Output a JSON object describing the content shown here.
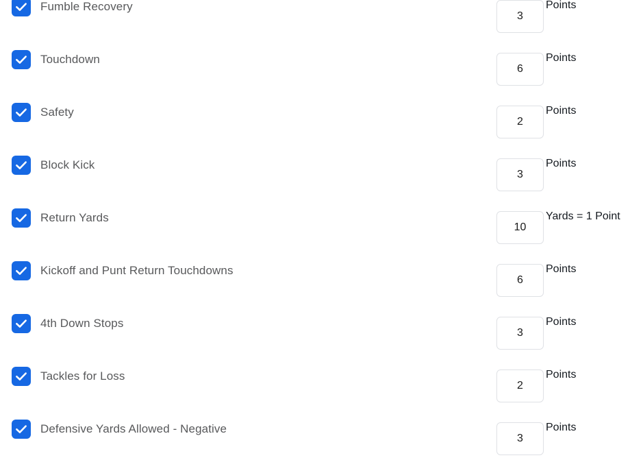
{
  "theme": {
    "background": "#ffffff",
    "checkbox_checked": "#1668e3",
    "checkbox_check_mark": "#ffffff",
    "label_color": "#58595b",
    "unit_color": "#14191f",
    "input_border": "#dfe1e5"
  },
  "scoring_rules": [
    {
      "label": "Fumble Recovery",
      "checked": true,
      "value": "3",
      "unit": "Points"
    },
    {
      "label": "Touchdown",
      "checked": true,
      "value": "6",
      "unit": "Points"
    },
    {
      "label": "Safety",
      "checked": true,
      "value": "2",
      "unit": "Points"
    },
    {
      "label": "Block Kick",
      "checked": true,
      "value": "3",
      "unit": "Points"
    },
    {
      "label": "Return Yards",
      "checked": true,
      "value": "10",
      "unit": "Yards = 1 Point"
    },
    {
      "label": "Kickoff and Punt Return Touchdowns",
      "checked": true,
      "value": "6",
      "unit": "Points"
    },
    {
      "label": "4th Down Stops",
      "checked": true,
      "value": "3",
      "unit": "Points"
    },
    {
      "label": "Tackles for Loss",
      "checked": true,
      "value": "2",
      "unit": "Points"
    },
    {
      "label": "Defensive Yards Allowed - Negative",
      "checked": true,
      "value": "3",
      "unit": "Points"
    }
  ]
}
